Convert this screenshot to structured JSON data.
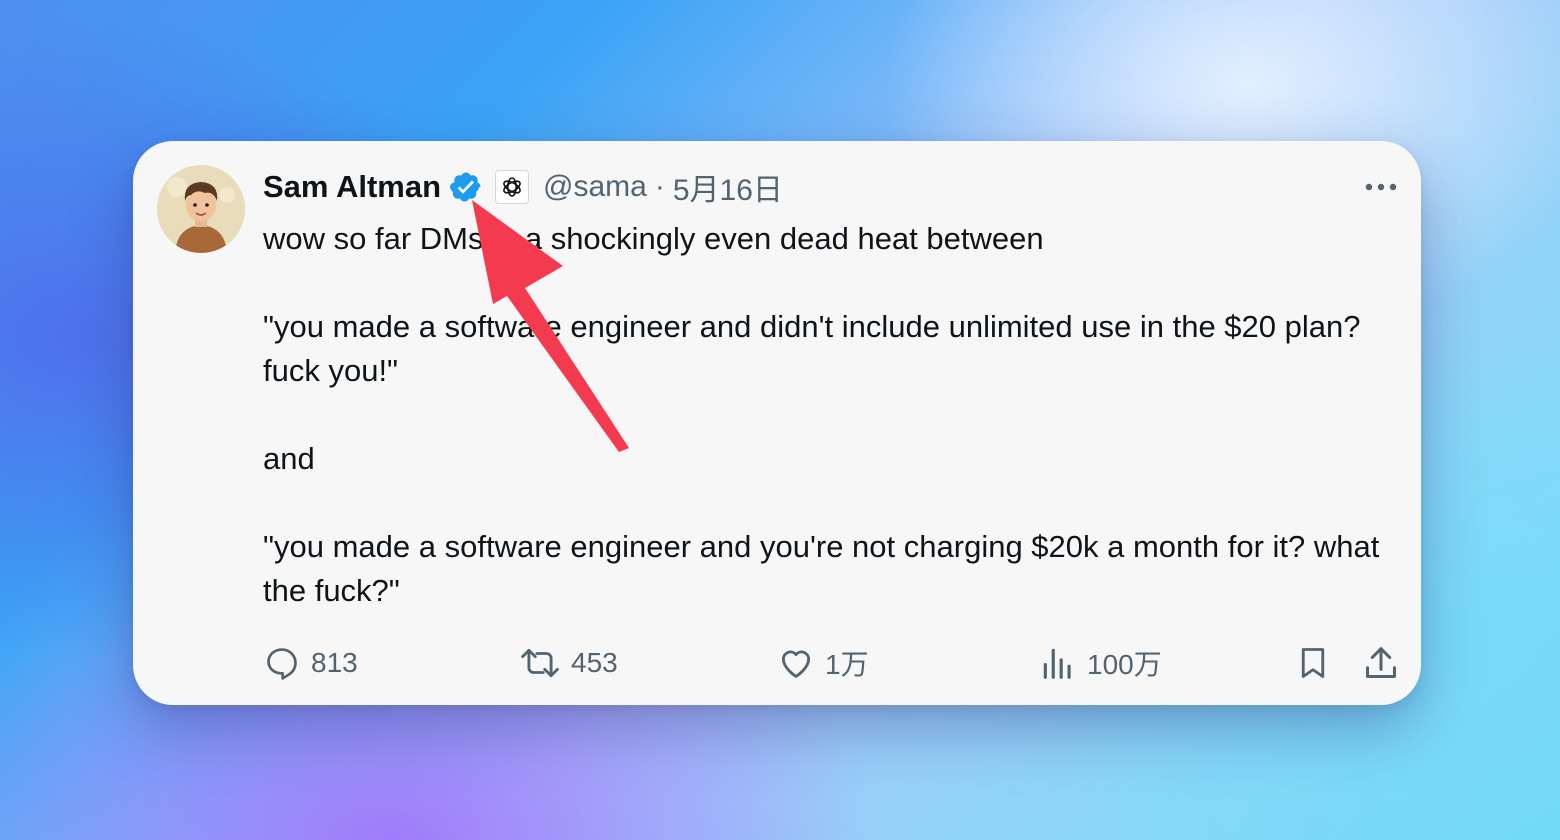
{
  "tweet": {
    "author_name": "Sam Altman",
    "handle": "@sama",
    "separator": "·",
    "date": "5月16日",
    "lines": {
      "l1": "wow so far DMs in a shockingly even dead heat between",
      "l2": "\"you made a software engineer and didn't include unlimited use in the $20 plan? fuck you!\"",
      "l3": "and",
      "l4": "\"you made a software engineer and you're not charging $20k a month for it? what the fuck?\""
    },
    "stats": {
      "replies": "813",
      "retweets": "453",
      "likes": "1万",
      "views": "100万"
    }
  },
  "colors": {
    "verified_blue": "#1d9bf0",
    "text_primary": "#0f1419",
    "text_secondary": "#536471",
    "annotation_arrow": "#f43a4f",
    "card_background": "#f7f7f7"
  },
  "icons": {
    "verified": "verified-badge-icon",
    "affiliation": "openai-logo-icon",
    "more": "more-options-icon",
    "reply": "reply-icon",
    "retweet": "retweet-icon",
    "like": "heart-icon",
    "views": "views-chart-icon",
    "bookmark": "bookmark-icon",
    "share": "share-icon",
    "annotation": "red-pointer-arrow-icon"
  }
}
